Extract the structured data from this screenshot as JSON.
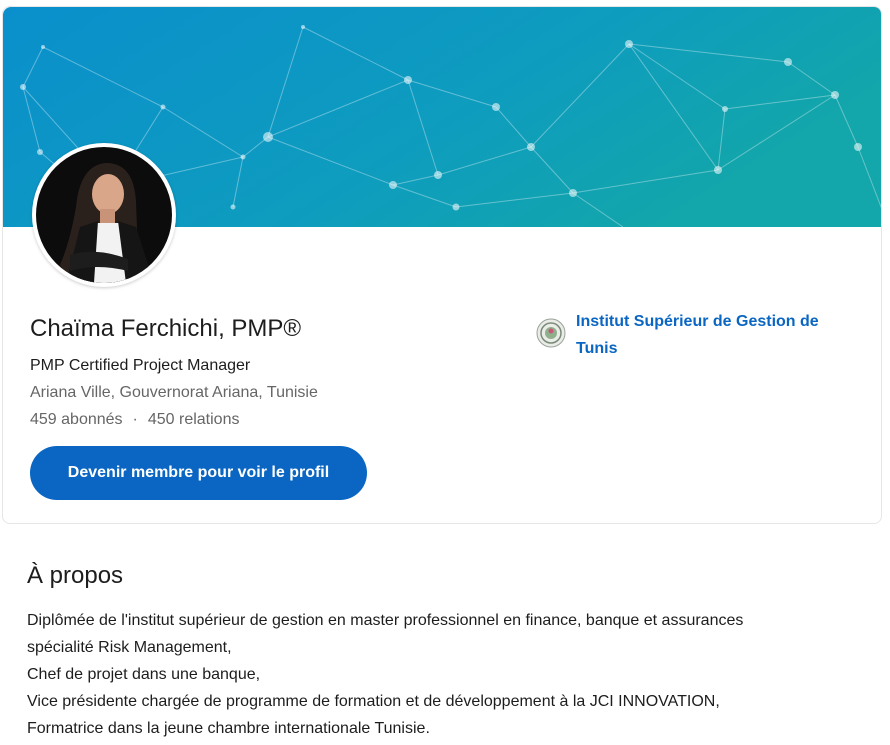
{
  "profile": {
    "name": "Chaïma Ferchichi, PMP®",
    "headline": "PMP Certified Project Manager",
    "location": "Ariana Ville, Gouvernorat Ariana, Tunisie",
    "followers": "459 abonnés",
    "separator": "·",
    "connections": "450 relations",
    "join_button_label": "Devenir membre pour voir le profil"
  },
  "education": {
    "school_name": "Institut Supérieur de Gestion de Tunis"
  },
  "about": {
    "title": "À propos",
    "lines": [
      "Diplômée de l'institut supérieur de gestion en master professionnel en finance, banque et assurances",
      "spécialité Risk Management,",
      "Chef de projet dans une banque,",
      "Vice présidente chargée de programme de formation et de développement à la JCI INNOVATION,",
      "Formatrice dans la jeune chambre internationale Tunisie."
    ]
  },
  "colors": {
    "accent": "#0a66c2",
    "banner_start": "#0b93c9",
    "banner_end": "#11a3ae",
    "text_primary": "#1d1d1d",
    "text_secondary": "#666666"
  },
  "icons": {
    "banner": "network-pattern-banner",
    "avatar": "profile-photo",
    "school": "school-logo-icon"
  }
}
